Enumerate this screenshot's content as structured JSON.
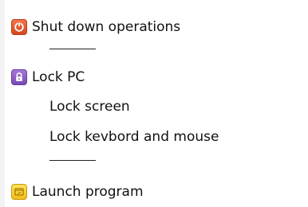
{
  "menu": {
    "items": [
      {
        "label": "Shut down operations",
        "icon": "power-icon"
      },
      {
        "label": "Lock PC",
        "icon": "lock-icon"
      },
      {
        "label": "Lock screen"
      },
      {
        "label": "Lock kevbord and mouse"
      },
      {
        "label": "Launch program",
        "icon": "launch-program-icon"
      }
    ]
  },
  "colors": {
    "power_icon": "#e0542a",
    "lock_icon": "#8a56c2",
    "launch_icon": "#f6cf2a",
    "text": "#111111"
  }
}
